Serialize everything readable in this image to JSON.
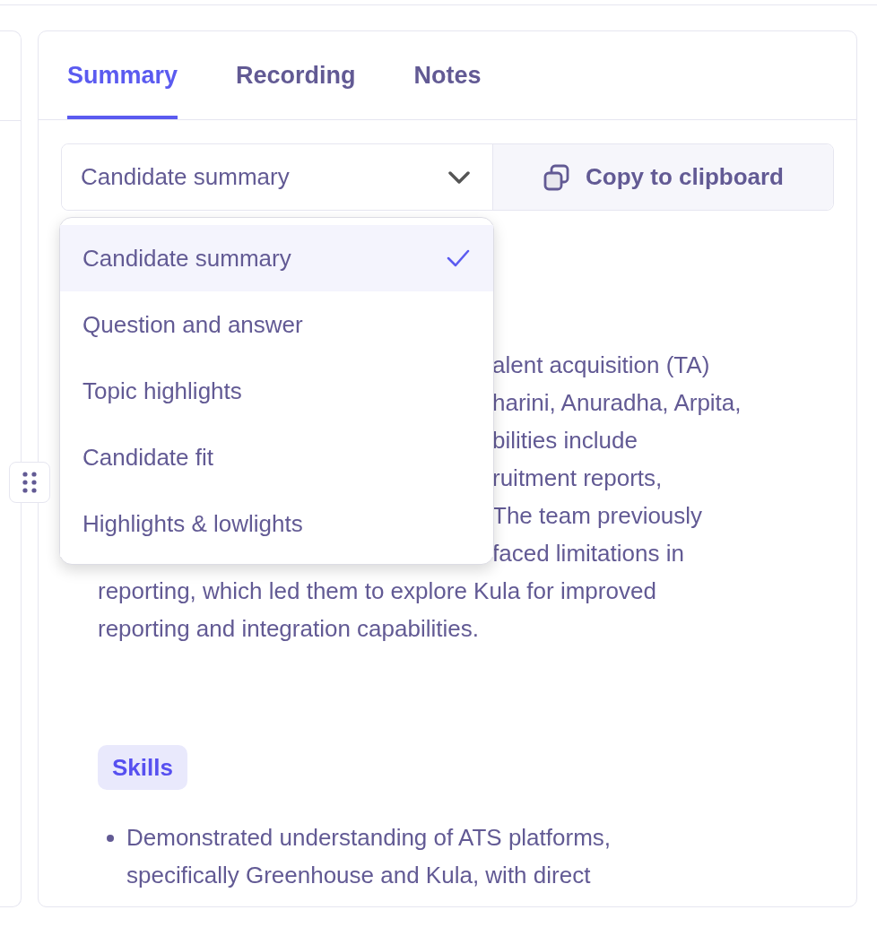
{
  "tabs": [
    {
      "label": "Summary",
      "selected": true
    },
    {
      "label": "Recording",
      "selected": false
    },
    {
      "label": "Notes",
      "selected": false
    }
  ],
  "summary_select": {
    "value": "Candidate summary",
    "expanded": true
  },
  "copy_button": {
    "label": "Copy to clipboard"
  },
  "dropdown": {
    "options": [
      {
        "label": "Candidate summary",
        "selected": true
      },
      {
        "label": "Question and answer",
        "selected": false
      },
      {
        "label": "Topic highlights",
        "selected": false
      },
      {
        "label": "Candidate fit",
        "selected": false
      },
      {
        "label": "Highlights & lowlights",
        "selected": false
      }
    ]
  },
  "summary": {
    "lines": [
      {
        "kind": "behind_menu",
        "text": "alent acquisition (TA)"
      },
      {
        "kind": "behind_menu",
        "text": "harini, Anuradha, Arpita,"
      },
      {
        "kind": "behind_menu",
        "text": "bilities include"
      },
      {
        "kind": "behind_menu",
        "text": "ruitment reports,"
      },
      {
        "kind": "behind_menu",
        "text": "The team previously"
      },
      {
        "kind": "behind_menu",
        "text": "faced limitations in"
      },
      {
        "kind": "full",
        "text": "reporting, which led them to explore Kula for improved"
      },
      {
        "kind": "full",
        "text": "reporting and integration capabilities."
      }
    ]
  },
  "skills": {
    "heading": "Skills",
    "items": [
      "Demonstrated understanding of ATS platforms, specifically Greenhouse and Kula, with direct"
    ]
  }
}
